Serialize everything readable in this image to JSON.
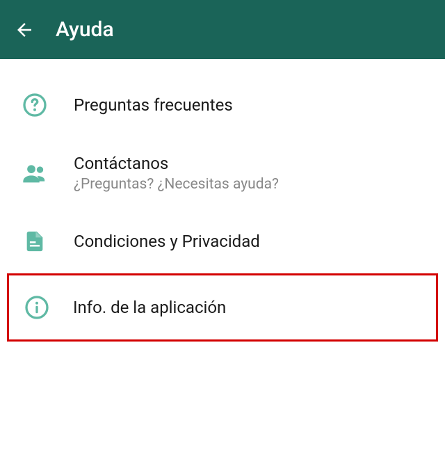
{
  "header": {
    "title": "Ayuda"
  },
  "items": {
    "faq": {
      "title": "Preguntas frecuentes"
    },
    "contact": {
      "title": "Contáctanos",
      "subtitle": "¿Preguntas? ¿Necesitas ayuda?"
    },
    "terms": {
      "title": "Condiciones y Privacidad"
    },
    "appinfo": {
      "title": "Info. de la aplicación"
    }
  },
  "colors": {
    "header_bg": "#1a6458",
    "icon_color": "#5fb9a4",
    "highlight_border": "#d30000"
  }
}
